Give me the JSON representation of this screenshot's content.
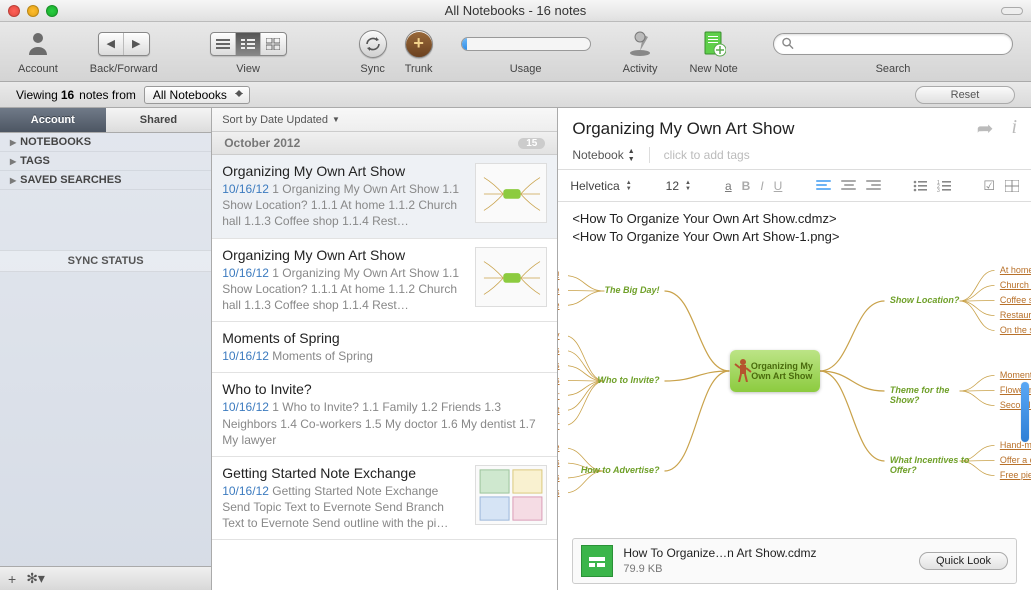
{
  "window": {
    "title": "All Notebooks - 16 notes"
  },
  "toolbar": {
    "account_label": "Account",
    "backforward_label": "Back/Forward",
    "view_label": "View",
    "sync_label": "Sync",
    "trunk_label": "Trunk",
    "usage_label": "Usage",
    "activity_label": "Activity",
    "newnote_label": "New Note",
    "search_label": "Search",
    "search_placeholder": ""
  },
  "filter": {
    "prefix": "Viewing ",
    "count": "16",
    "mid": " notes from",
    "selector": "All Notebooks",
    "reset": "Reset"
  },
  "sidebar": {
    "tabs": {
      "account": "Account",
      "shared": "Shared"
    },
    "nav": [
      "NOTEBOOKS",
      "TAGS",
      "SAVED SEARCHES"
    ],
    "sync_status": "SYNC STATUS"
  },
  "sortbar": {
    "label": "Sort by Date Updated"
  },
  "month_header": {
    "label": "October 2012",
    "count": "15"
  },
  "notes": [
    {
      "title": "Organizing My Own Art Show",
      "date": "10/16/12",
      "snippet": "1 Organizing My Own Art Show 1.1 Show Location? 1.1.1 At home 1.1.2 Church hall 1.1.3 Coffee shop 1.1.4 Rest…",
      "selected": true,
      "thumb": "mindmap"
    },
    {
      "title": "Organizing My Own Art Show",
      "date": "10/16/12",
      "snippet": "1 Organizing My Own Art Show 1.1 Show Location? 1.1.1 At home 1.1.2 Church hall 1.1.3 Coffee shop 1.1.4 Rest…",
      "thumb": "mindmap"
    },
    {
      "title": "Moments of Spring",
      "date": "10/16/12",
      "snippet": "Moments of Spring"
    },
    {
      "title": "Who to Invite?",
      "date": "10/16/12",
      "snippet": "1 Who to Invite? 1.1 Family 1.2 Friends 1.3 Neighbors 1.4 Co-workers 1.5 My doctor 1.6 My dentist 1.7 My lawyer"
    },
    {
      "title": "Getting Started Note Exchange",
      "date": "10/16/12",
      "snippet": "Getting Started Note Exchange Send Topic Text to Evernote Send Branch Text to Evernote Send outline with the pi…",
      "thumb": "blocks"
    }
  ],
  "detail": {
    "title": "Organizing My Own Art Show",
    "notebook_label": "Notebook",
    "add_tags": "click to add tags",
    "font_name": "Helvetica",
    "font_size": "12",
    "attlines": [
      "<How To Organize Your Own Art Show.cdmz>",
      "<How To Organize Your Own Art Show-1.png>"
    ],
    "attachment": {
      "name": "How To Organize…n Art Show.cdmz",
      "size": "79.9 KB",
      "quick_look": "Quick Look"
    }
  },
  "mindmap": {
    "center": "Organizing My Own Art Show",
    "left": [
      {
        "topic": "The Big Day!",
        "items": [
          "ENJOY!",
          "Talk to people",
          "Be hospitable"
        ]
      },
      {
        "topic": "Who to Invite?",
        "items": [
          "Family",
          "Friends",
          "Neighbors",
          "Co-workers",
          "My doctor",
          "My dentist",
          "My lawyer"
        ]
      },
      {
        "topic": "How to Advertise?",
        "items": [
          "Send a press release",
          "Call reporters",
          "Hang posters",
          "Give out flyers"
        ]
      }
    ],
    "right": [
      {
        "topic": "Show Location?",
        "items": [
          "At home",
          "Church hall",
          "Coffee shop",
          "Restaurant",
          "On the street"
        ]
      },
      {
        "topic": "Theme for the Show?",
        "items": [
          "Moments of Spring",
          "Flowering Inspiration",
          "Second Breath"
        ]
      },
      {
        "topic": "What Incentives to Offer?",
        "items": [
          "Hand-made postcards",
          "Offer a discount!",
          "Free piece of art"
        ]
      }
    ]
  }
}
